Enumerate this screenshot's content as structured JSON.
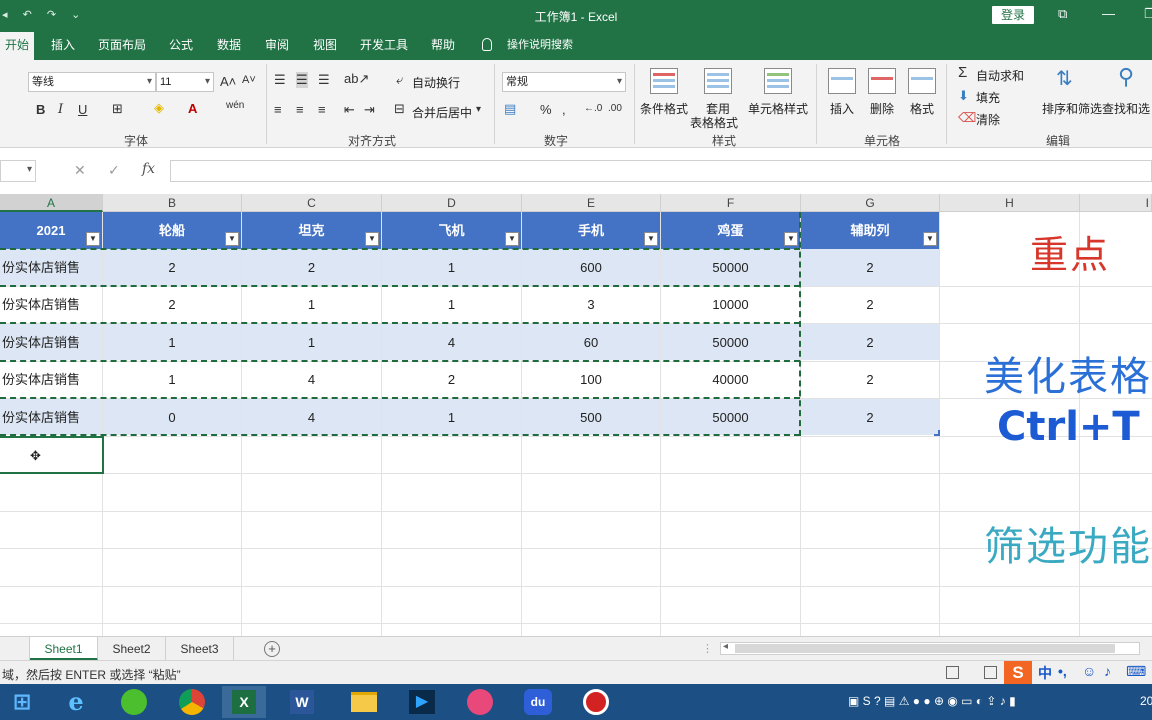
{
  "window": {
    "title": "工作簿1 - Excel",
    "login_label": "登录"
  },
  "ribbon_tabs": [
    "开始",
    "插入",
    "页面布局",
    "公式",
    "数据",
    "审阅",
    "视图",
    "开发工具",
    "帮助"
  ],
  "tell_me": "操作说明搜索",
  "ribbon": {
    "font_name": "等线",
    "font_size": "11",
    "number_format": "常规",
    "wrap_text": "自动换行",
    "merge_center": "合并后居中",
    "conditional_format": "条件格式",
    "format_as_table_1": "套用",
    "format_as_table_2": "表格格式",
    "cell_styles": "单元格样式",
    "insert": "插入",
    "delete": "删除",
    "format": "格式",
    "autosum": "自动求和",
    "fill": "填充",
    "clear": "清除",
    "sort_filter": "排序和筛选",
    "find_select": "查找和选",
    "groups": {
      "font": "字体",
      "alignment": "对齐方式",
      "number": "数字",
      "styles": "样式",
      "cells": "单元格",
      "editing": "编辑"
    }
  },
  "formula_bar": {
    "cancel": "✕",
    "confirm": "✓",
    "fx": "fx"
  },
  "columns": [
    "A",
    "B",
    "C",
    "D",
    "E",
    "F",
    "G",
    "H",
    "I"
  ],
  "table": {
    "headers": [
      "2021",
      "轮船",
      "坦克",
      "飞机",
      "手机",
      "鸡蛋",
      "辅助列"
    ],
    "rows": [
      [
        "份实体店销售",
        "2",
        "2",
        "1",
        "600",
        "50000",
        "2"
      ],
      [
        "份实体店销售",
        "2",
        "1",
        "1",
        "3",
        "10000",
        "2"
      ],
      [
        "份实体店销售",
        "1",
        "1",
        "4",
        "60",
        "50000",
        "2"
      ],
      [
        "份实体店销售",
        "1",
        "4",
        "2",
        "100",
        "40000",
        "2"
      ],
      [
        "份实体店销售",
        "0",
        "4",
        "1",
        "500",
        "50000",
        "2"
      ]
    ]
  },
  "annotations": {
    "key_point": "重点",
    "beautify": "美化表格",
    "shortcut": "Ctrl+T",
    "filter": "筛选功能"
  },
  "sheets": [
    "Sheet1",
    "Sheet2",
    "Sheet3"
  ],
  "active_sheet": "Sheet1",
  "status": {
    "message": "域，然后按 ENTER 或选择 “粘贴”",
    "ime": "中"
  },
  "taskbar": {
    "apps": [
      "windows-start",
      "ie-browser",
      "360-browser",
      "chrome",
      "excel",
      "word",
      "file-explorer",
      "media-player",
      "music-app",
      "baidu",
      "screen-recorder"
    ],
    "excel_label": "X",
    "word_label": "W",
    "baidu_label": "du",
    "clock_fragment": "20"
  },
  "colors": {
    "excel_green": "#217346",
    "table_header_blue": "#4472c4",
    "band_light_blue": "#dce6f4",
    "key_point_red": "#d7362a",
    "annotation_blue": "#2a70d6",
    "annotation_cyan": "#3aa9c2"
  }
}
